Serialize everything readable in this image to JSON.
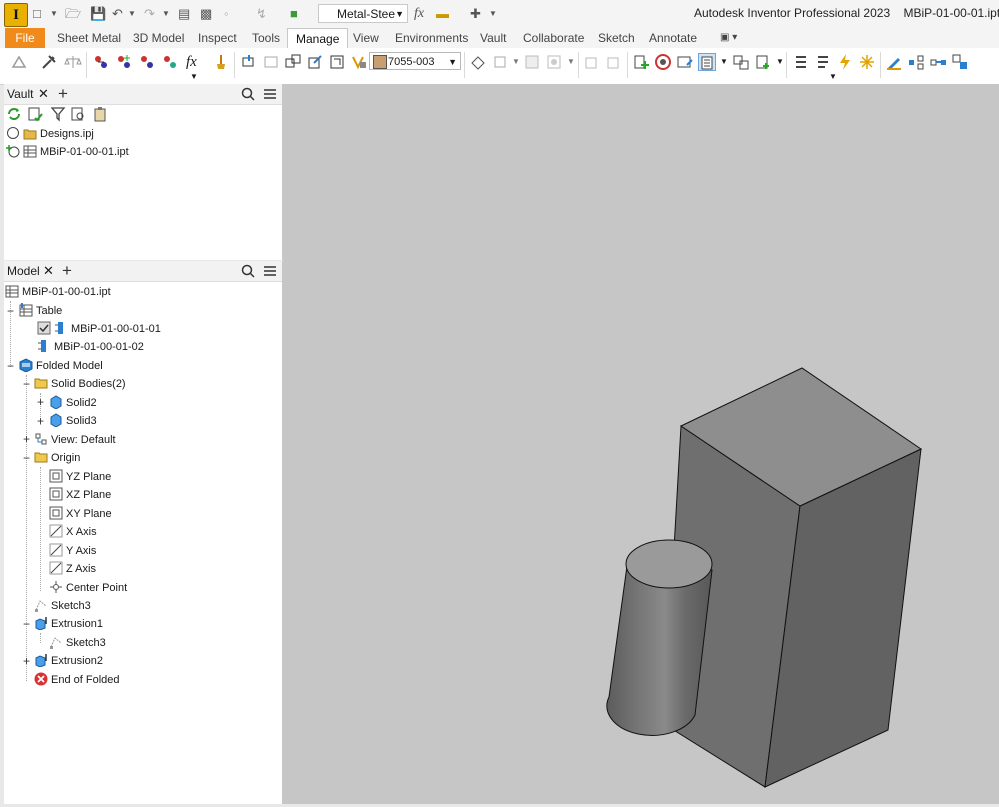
{
  "app": {
    "logo_letter": "I",
    "title": "Autodesk Inventor Professional 2023",
    "document": "MBiP-01-00-01.ipt",
    "material": "Metal-Stee",
    "formula_symbol": "fx"
  },
  "tabs": [
    {
      "label": "File"
    },
    {
      "label": "Sheet Metal"
    },
    {
      "label": "3D Model"
    },
    {
      "label": "Inspect"
    },
    {
      "label": "Tools"
    },
    {
      "label": "Manage"
    },
    {
      "label": "View"
    },
    {
      "label": "Environments"
    },
    {
      "label": "Vault"
    },
    {
      "label": "Collaborate"
    },
    {
      "label": "Sketch"
    },
    {
      "label": "Annotate"
    }
  ],
  "active_tab": "Manage",
  "ribbon": {
    "member_combo": "7055-003",
    "formula_symbol": "fx"
  },
  "vault_panel": {
    "title": "Vault",
    "items": [
      {
        "label": "Designs.ipj",
        "icon": "project-file-icon"
      },
      {
        "label": "MBiP-01-00-01.ipt",
        "icon": "part-file-icon"
      }
    ]
  },
  "model_panel": {
    "title": "Model",
    "root": "MBiP-01-00-01.ipt",
    "nodes": [
      {
        "label": "Table"
      },
      {
        "label": "MBiP-01-00-01-01"
      },
      {
        "label": "MBiP-01-00-01-02"
      },
      {
        "label": "Folded Model"
      },
      {
        "label": "Solid Bodies(2)"
      },
      {
        "label": "Solid2"
      },
      {
        "label": "Solid3"
      },
      {
        "label": "View: Default"
      },
      {
        "label": "Origin"
      },
      {
        "label": "YZ Plane"
      },
      {
        "label": "XZ Plane"
      },
      {
        "label": "XY Plane"
      },
      {
        "label": "X Axis"
      },
      {
        "label": "Y Axis"
      },
      {
        "label": "Z Axis"
      },
      {
        "label": "Center Point"
      },
      {
        "label": "Sketch3"
      },
      {
        "label": "Extrusion1"
      },
      {
        "label": "Sketch3"
      },
      {
        "label": "Extrusion2"
      },
      {
        "label": "End of Folded"
      }
    ]
  },
  "colors": {
    "file_tab": "#f08b1b",
    "app_logo": "#e8b000",
    "viewport_bg": "#c6c6c6",
    "solid_body": "#7a7a7a"
  }
}
